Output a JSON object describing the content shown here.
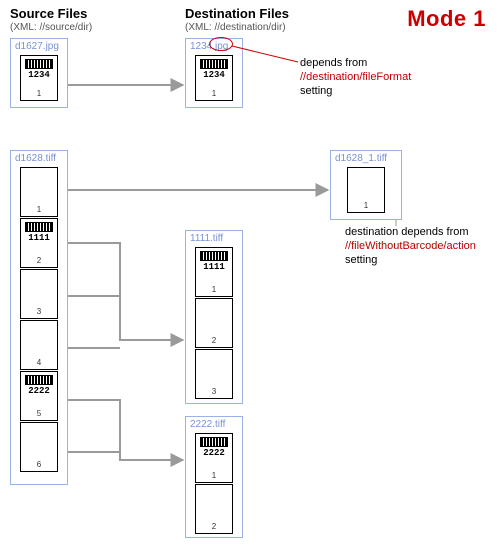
{
  "mode_label": "Mode 1",
  "headings": {
    "source": "Source Files",
    "source_sub_pre": "(XML: ",
    "source_sub_path": "//source/dir",
    "source_sub_post": ")",
    "dest": "Destination Files",
    "dest_sub_pre": "(XML: ",
    "dest_sub_path": "//destination/dir",
    "dest_sub_post": ")"
  },
  "files": {
    "src1": {
      "name": "d1627.jpg",
      "pages": [
        {
          "barcode": "1234",
          "n": "1"
        }
      ]
    },
    "src2": {
      "name": "d1628.tiff",
      "pages": [
        {
          "barcode": null,
          "n": "1"
        },
        {
          "barcode": "1111",
          "n": "2"
        },
        {
          "barcode": null,
          "n": "3"
        },
        {
          "barcode": null,
          "n": "4"
        },
        {
          "barcode": "2222",
          "n": "5"
        },
        {
          "barcode": null,
          "n": "6"
        }
      ]
    },
    "dst1": {
      "name": "1234.jpg",
      "pages": [
        {
          "barcode": "1234",
          "n": "1"
        }
      ]
    },
    "dst2": {
      "name": "d1628_1.tiff",
      "pages": [
        {
          "barcode": null,
          "n": "1"
        }
      ]
    },
    "dst3": {
      "name": "1111.tiff",
      "pages": [
        {
          "barcode": "1111",
          "n": "1"
        },
        {
          "barcode": null,
          "n": "2"
        },
        {
          "barcode": null,
          "n": "3"
        }
      ]
    },
    "dst4": {
      "name": "2222.tiff",
      "pages": [
        {
          "barcode": "2222",
          "n": "1"
        },
        {
          "barcode": null,
          "n": "2"
        }
      ]
    }
  },
  "annotations": {
    "a1_line1": "depends from",
    "a1_path": "//destination/fileFormat",
    "a1_line3": "setting",
    "a2_line1": "destination depends from",
    "a2_path": "//fileWithoutBarcode/action",
    "a2_line3": "setting"
  },
  "colors": {
    "accent": "#c00",
    "box_border": "#99b3e6",
    "label_blue": "#7891d6"
  }
}
